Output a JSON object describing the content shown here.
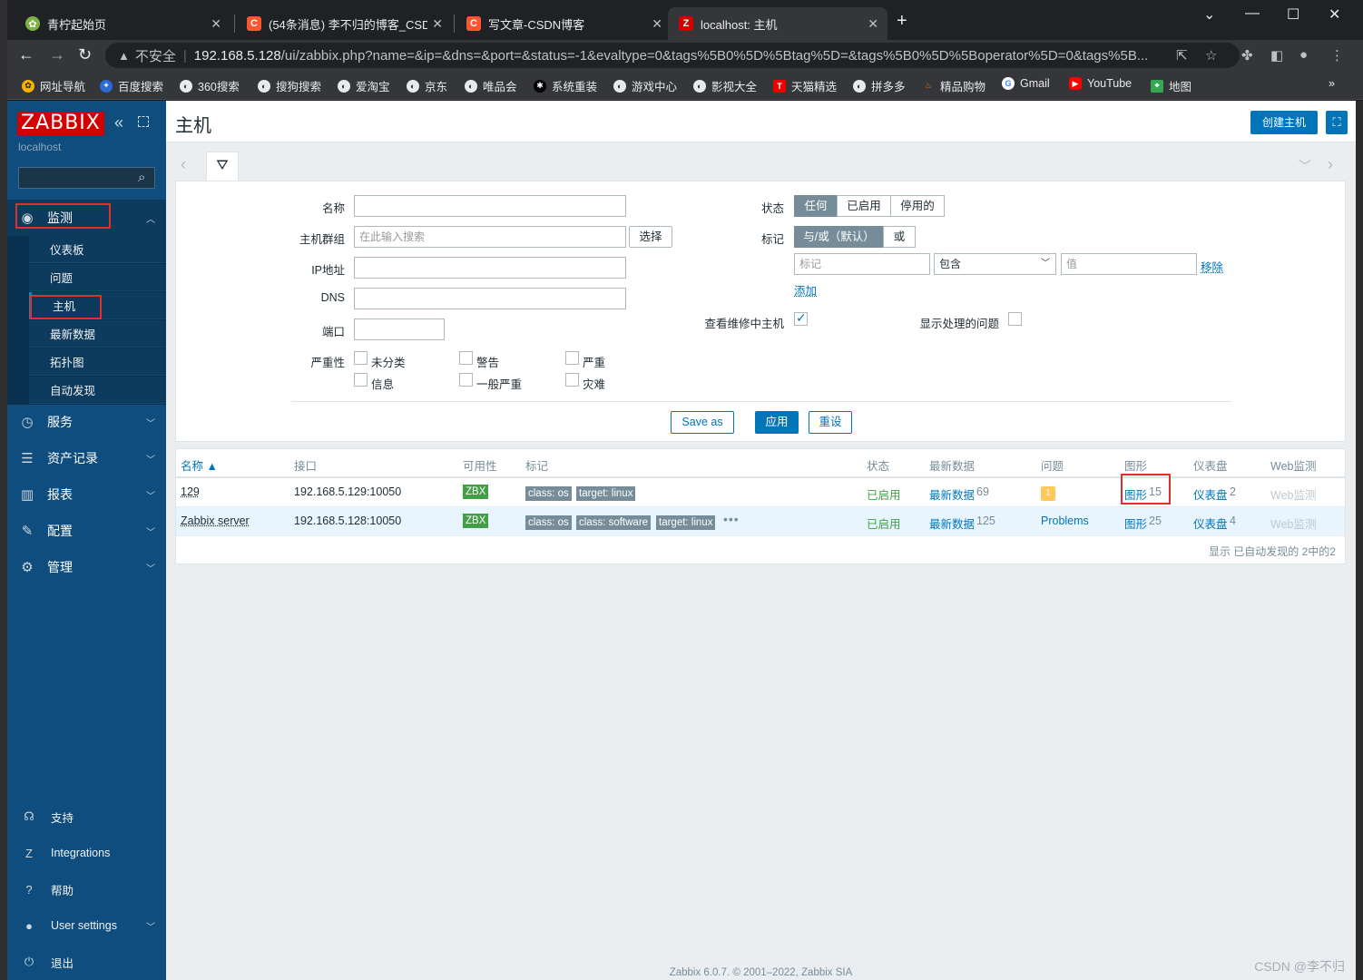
{
  "browser": {
    "tabs": [
      {
        "title": "青柠起始页",
        "icon": "green-flower-icon",
        "color": "#7cb342"
      },
      {
        "title": "(54条消息) 李不归的博客_CSDN",
        "icon": "csdn-c-icon",
        "color": "#fc5531"
      },
      {
        "title": "写文章-CSDN博客",
        "icon": "csdn-c-icon",
        "color": "#fc5531"
      },
      {
        "title": "localhost: 主机",
        "icon": "zabbix-z-icon",
        "color": "#d40000"
      }
    ],
    "insecure_label": "不安全",
    "url_host": "192.168.5.128",
    "url_rest": "/ui/zabbix.php?name=&ip=&dns=&port=&status=-1&evaltype=0&tags%5B0%5D%5Btag%5D=&tags%5B0%5D%5Boperator%5D=0&tags%5B...",
    "bookmarks": [
      "网址导航",
      "百度搜索",
      "360搜索",
      "搜狗搜索",
      "爱淘宝",
      "京东",
      "唯品会",
      "系统重装",
      "游戏中心",
      "影视大全",
      "天猫精选",
      "拼多多",
      "精品购物",
      "Gmail",
      "YouTube",
      "地图"
    ]
  },
  "sidebar": {
    "logo": "ZABBIX",
    "server_name": "localhost",
    "menu": {
      "monitoring": "监测",
      "services": "服务",
      "inventory": "资产记录",
      "reports": "报表",
      "configuration": "配置",
      "administration": "管理"
    },
    "monitoring_sub": [
      "仪表板",
      "问题",
      "主机",
      "最新数据",
      "拓扑图",
      "自动发现"
    ],
    "bottom": {
      "support": "支持",
      "integrations": "Integrations",
      "help": "帮助",
      "user_settings": "User settings",
      "signout": "退出"
    }
  },
  "header": {
    "title": "主机",
    "create_host": "创建主机"
  },
  "filter": {
    "name_label": "名称",
    "group_label": "主机群组",
    "group_placeholder": "在此输入搜索",
    "select_btn": "选择",
    "ip_label": "IP地址",
    "dns_label": "DNS",
    "port_label": "端口",
    "severity_label": "严重性",
    "severities": [
      "未分类",
      "警告",
      "严重",
      "信息",
      "一般严重",
      "灾难"
    ],
    "status_label": "状态",
    "status_options": [
      "任何",
      "已启用",
      "停用的"
    ],
    "tags_label": "标记",
    "tag_eval_options": [
      "与/或（默认）",
      "或"
    ],
    "tag_placeholder": "标记",
    "tag_operator": "包含",
    "value_placeholder": "值",
    "remove": "移除",
    "add": "添加",
    "maintenance_label": "查看维修中主机",
    "show_suppressed_label": "显示处理的问题",
    "save_as": "Save as",
    "apply": "应用",
    "reset": "重设"
  },
  "table": {
    "columns": [
      "名称 ▲",
      "接口",
      "可用性",
      "标记",
      "状态",
      "最新数据",
      "问题",
      "图形",
      "仪表盘",
      "Web监测"
    ],
    "rows": [
      {
        "name": "129",
        "interface": "192.168.5.129:10050",
        "availability": "ZBX",
        "tags": [
          "class: os",
          "target: linux"
        ],
        "status": "已启用",
        "latest_data": "最新数据",
        "latest_count": "69",
        "problems": "1",
        "graphs": "图形",
        "graphs_count": "15",
        "dashboards": "仪表盘",
        "dashboards_count": "2",
        "web": "Web监测"
      },
      {
        "name": "Zabbix server",
        "interface": "192.168.5.128:10050",
        "availability": "ZBX",
        "tags": [
          "class: os",
          "class: software",
          "target: linux"
        ],
        "status": "已启用",
        "latest_data": "最新数据",
        "latest_count": "125",
        "problems": "Problems",
        "graphs": "图形",
        "graphs_count": "25",
        "dashboards": "仪表盘",
        "dashboards_count": "4",
        "web": "Web监测"
      }
    ],
    "footer": "显示 已自动发现的 2中的2"
  },
  "footer": "Zabbix 6.0.7. © 2001–2022, Zabbix SIA",
  "watermark": "CSDN @李不归"
}
